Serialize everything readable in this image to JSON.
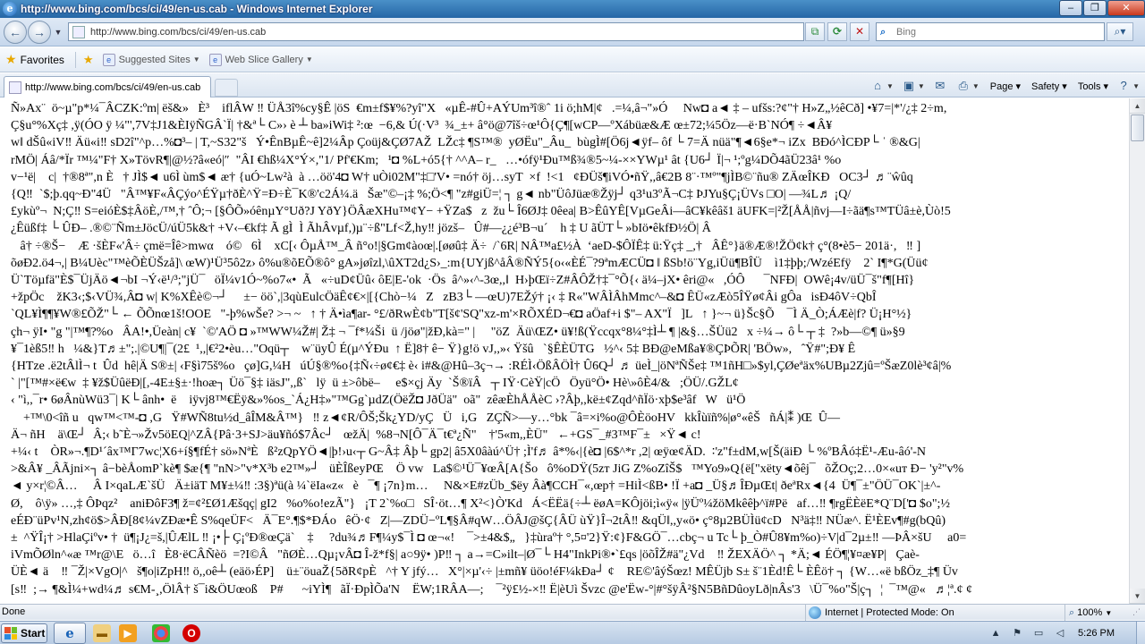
{
  "window": {
    "title": "http://www.bing.com/bcs/ci/49/en-us.cab - Windows Internet Explorer",
    "minimize": "–",
    "restore": "❐",
    "close": "✕"
  },
  "address": {
    "url": "http://www.bing.com/bcs/ci/49/en-us.cab",
    "search_placeholder": "Bing"
  },
  "favorites_bar": {
    "favorites_label": "Favorites",
    "items": [
      {
        "label": "Suggested Sites"
      },
      {
        "label": "Web Slice Gallery"
      }
    ]
  },
  "tab": {
    "label": "http://www.bing.com/bcs/ci/49/en-us.cab"
  },
  "command_bar": {
    "page": "Page",
    "safety": "Safety",
    "tools": "Tools"
  },
  "content": {
    "lines": [
      "Ñ»Ax¨  ö~µ\"p*¼¯ÂCZK:ºm| ëš&»   È³    iflÂW ‼ ÜÅ3î%cy§Ê |öS  €m±f$¥%?yî\"X   «µÊ-#Û+AÝUm³î®ˆ 1i ö;hM|¢   .=¼,â¬\"»Ó     Nw◘ a◄ ‡ – ufšs:?¢\"† H»Z„½êCð] •¥7=|*'/¿‡ 2÷m,",
      "Ç§u°%Xç‡ ,ÿ(ÓO ÿ ¼\"',7V‡J1&ÈIÿÑGÂ`Ï| †&ª└ C»› è ┴ ba»iWi‡ ²:œ  −6,& Ú(·V³  ¾_±+ â°ö@7îš÷œ¹Ô{Ç¶[wCP—ºXábüæ&Æ œ±72;¼5Öz—ë·B`NÓ¶ ÷◄Â¥",
      "w‖ dŠû«iV‼ Äü«i‼ sD2î\"^p…%◘³– | T,~S32\"š   Ý•ÊnBµÊ~ê]2¼Âp Çoüj&ÇØ7AŽ  LŽc‡ ¶S™®  yØËu\"_Âu_  bùgÌ#[Ö6j◄ÿf– ôf └ 7=Ä nüä\"¶◄6§e*¬ iZx  BÐó^ÌCÐP└ ˈ ®&G|",
      "rMÖ| Áâ/*Ïr ™¼\"F† X»TövR¶|@½?â«eó|″  \"ÂI €hß¼X°Ý×,\"1/ Pf'€Km;   ¹◘ %L+ó5{† ^^A– r_   …•ófÿ¹Ðu™ß¾®5~¼-××YWµ¹ ât {U6┘ Ï|¬ ¹;ºg¼DÕ4ãÜ23â¹ %o",
      "v−¹ë|    c|  †®8ª\",n È   † JÌ$◄ u6Ì ùm$◄ æ† {uÓ~Lw²à  à …öö'4◘ W† uÒi02M\"‡□'V• =nó† öj…syT  ×f  !<1   ¢ÐÜš¶iVÓ•ñŸ,,â€2B 8¨·™º\"¶jÌB©¨ñu® ZÄœÎKÐ   OC3┘ ♬¨ŵûq",
      "{Q‼  `$;þ.qq~Ð\"4Ü   \"Â™¥F«ÂÇýo^ÉŸµ†ðÈ^Ÿ=Ð÷È¯K®'c2Á¼.ä   Šæ\"©–¡‡ %;Ö<¶ \"z#giÜ=¦ ┐ g◄ nb\"ÜôJüæ®Žÿj┘ q3¹u3ºÃ¬C‡ ÞJYu§Ç¡ÜVs □O| —¾L♬ ¡Q/",
      "£ykùº¬  N;Ç‼ S=eióÈ$‡ÂöÈ,/™,† ˆÔ;¬ [§ÔÕ»óênµY°Uð?J YðY}ÖÂæXHu™¢Y− +ŸZa$   z  žu└ Î6ØJ‡ 0êea| B>ÊûYÊ[VµGeÂi—âC¥kêâš1 äUFK=|²Ž[ÅÅ|ñvj—I÷ãä¶s™TÜâ±è,Ùò!5",
      "¿Êüßf‡ └ ÛÐ– .®©¨Ñm±JöcÜ/úÜ5k&† +V‹–€kf‡ Ã gÌ  Ì ÃhÂvµf,)µ¨÷ß\"Lf<Ž,hy‼ jözš–   Û#—¿¿é³B¬u´    h ‡ U ãÜT└ »bIö•êkfÐ½Ö| Â",
      "   â† ÷®Š−    Æ ·šÈF«'Â÷ çmë=Îê>mwα    ó©   6Ì    xC[‹ ÔµÅ™_Â ñ°o!|§Gm¢àoœ|.[øøû‡ Ä÷  /`6R| NÂ™a£½À  ‘aeD-$ÔÏÊ‡ ü:Ÿç‡ _,†   ÂÊ°}ä®Æ®!ŽÖ¢k† ç°(8•è5− 201ä·,   ‼ ]",
      "õøÐ2.ö4¬,| B¼Uèc\"™èÕÈÜŠzå]\\ œW)¹Ü³5ô2z› ô%u®õEÕ®ô° gA»jøîzl,\\ûXT2d¿S›_:m{UYjß^åÂ®ÑÝ5{o‹«ÈÉ¯?9ªmÆCÜ◘ ‖ ßSb!ö¨Yg,iÜü¶BÎÜ    ì1‡þþ;/WzéEfÿ    2` I¶*G(Üü¢",
      "Ü`Töµfä\"È$¯ÜjÄö◄¬bI ¬Ý‹ë¹/³;\"jÜ¯   öÏ¼v1Ó~%o7«•  Ã   «÷uD¢Üû‹ ôE|E-'ok  ·Ös  â^»‹^-3œ,,‖  H›þŒï÷Z#ÂÔŽ†‡¯°Õ{‹ ä¼–jX• êri@«   ,ÓÔ      ¯NFÐ|  OWê¡4v/üÜ¯š\"f¶[Hî}",
      "+žpÖc    žK3‹;$‹VÜ¾,Â◘ w| K%XÊè©¬┘     ±− öö`,|3qùEulcÖäÊ¢€×|[{Chò−¼   Z   zB3└ —œU)7EŽý† ¡‹ ‡ R«\"WÂÌÂhMmc^–&◘ ÊÜ«zÆò5ÎŸø¢Âi gÔa   isÐ4ôV÷QbÎ",
      "`QL¥Ì¶¶¥W®£ÕŽ\"└ ← ÕÕnœ1š!OOE   \"-þ%wŠe? >¬ ~   ↑ † Ä•ìa¶ar- °£/ðRwÈ¢b\"T[š¢'SQ\"xz-m'×RÕXÉD¬€◘ aÖaf+i $\"– AX\"Ï   ]L   ↑ }~¬ ü}Šc§Õ    ¯Ì Ä_Ò;ÁÆè|f? Ü¡H°½}",
      "çh¬ ÿI• \"g \"|™¶?%o   ÂA!•,Üeàn| c¥  `©'AÖ ◘ »™WW¼Ž#| Ž‡ ¬ ¯f*¼Ši  ü /jöø\"|žÐ,kà=\" |     \"öZ  Äü\\ŒZ• ü¥!ß(Ÿccqx°8¼°‡Ì┴ ¶ |&§…ŠÜü2   x ÷¼→ ô└ ┬ ‡  ?»b—©¶ ü»§9",
      "¥¯1èß5‼ h   ¼&}T♬±\";.|©U¶|¯(2£  ¹,,|€²2•èu…\"Oqü┬    w¨üyÛ É(µ^ÝÐu  ↑ Ë]8† ê− Ÿ}g!ö vJ,,»‹ Ÿšû   `§ÊÈÜTG   ½^‹ 5‡ BÐ@eMßa¥®ÇÞÕR| 'BÖw»,   ˆŸ#\";Ð¥ Ê",
      "{HTze .ë2tÂlÌ¬ t  Ûd  hê|Ä S®±| ‹F§ì75š%o   çø]G,¼H   úÚ§®%o{‡Ñ‹÷ø¢€‡ è‹ i#&@Hû–3ç¬→ :RÉÌ‹ÖßÂÖÌ† Û6Q┘ ♬ üeÌ_|öNªÑŠe‡ ™1ñH□»$yl,ÇØeªäx%UBµ2Zjû=ºŠæZ0lè³¢â|%",
      "` |\"[™#×ë€w  ‡ ¥ž$ÜûëÐ|[,-4E±§±·!hoæ┐ Üö¯§‡ iäsJ\",,ß`   lÿ  ü ±>ôbë–     e$×çj Äy  `Š®ïÂ   ┬ IŸ·CèŸ|cÖ   Öyü°Ö• Hè\\»ôÈ4/&   ;ÖÜ/.GŽL¢",
      "‹ \"ì,,¯r• 6øÂnùWü3¯| K└ ânh•  ë    iÿvj8™€Ëÿ&»%os_`Á¿H‡»\"™Gg`µdZ(ÖëŽ◘ JðÜä\"  oã\"  zêæÈhÅÅèC ›?Âþ,,kë±¢Zqd^ñÏö·xþ$e³âf   W   ü¹Ö",
      "    +™\\0<îñ u   qw™<™-◘ ,G   Ÿ#WÑ8tu½d_âÎM&Â™}   ‼ z◄¢R/ÔŠ;Šk¿YD/yÇ   Ü   i,G   ZÇÑ>—y…°bk ¯â=×i%o@ÔÈöoHV   kkÎùïñ%|ø°«êŠ   ñÁ|⁑ )Œ  Û—",
      "Ä¬ ñH    ä\\Œ┘  Â;‹ b˜È¬»Žv5öEQ|^ZÂ{Pâ·3+SJ>äu¥ñó$7Âc┘   œžÄ|  %8¬N[Ô¯Ä¯t€ª¿Ñ\"    †'5«m,,ÈÜ\"   ←+GS¯_#3™F¯±   ×Ÿ◄ c!",
      "+¼‹ t    ÒR»¬.¶D¹´âx™Γ7wc¦X6+í§¶fÉ† sö»NªÈ   ß²zQpYÖ◄|þ!›u‹┬ G~Â‡ Âþ└ gp2| â5X0âàú^Ü† ;Ì'f♬ â*%‹|{è◘ |6$^*r ,2| œÿœ¢ÄD.  ∶'z\"f±dM,w[Š(äiÐ └ %ºBÂó‡Ë¹-Æu-âó'-N",
      ">&Â¥ _ÂÃjni×┐ â−bèÅomP`kè¶ $æ{¶ \"nN>\"v*X³b e2™»┘   üÈÎßeyPŒ    Ö vw   La$©¹Ü¯¥œÂ[A{Šo   ô%oDŸ(5zт JiG Z%oZîŠ$   ™Yo9»Q{ë[\"xëty◄õêj¯   õŽOç;2…0×«uт Ð− 'y²\"v%",
      "◄ y×r¦©Â…     Â I×qaLÆ`šÜ   Ä±iäT M¥±¼‼ :3§)ªü(à ¼`ëIa«z«   è   ¯¶ ¡7n}m…     N&×E#zÜb_$ëy Âà¶CCH¯«,œp† =HiÌ<ßB• !Ï +a◘ _Ü§♬ÎÐµŒt| ðeªRx◄{4  Ü¶¯±\"ÖÜ¯OK`|±^-",
      "Ø,    ô\\ÿ» …,‡ ÔÞqz²    aniÐôF3¶ ž=¢²£Ø1Æšqç| gI2   %o%o!ezÃ\"}   ¡T 2`%o□   SÎ·öt…¶ X²<}Ò'Kd   Á<ËËä{÷┴ ëøA=KÔjöi;ì«ÿ« |ÿÜº¼žöMkêêþ^ï#Pë   af…‼ ¶rgËÈëE*Q¨D['◘ $o\";½",
      "eÉÐ¨üPv¹N,zh¢ö$>ÂÐ[8¢¼vZÐæ•Ê S%qeÜF<   Ä¯E°.¶$*ÐÁo   êÖ·¢   Z|—ZDÜ−ºL¶§Â#qW…ÖÂJ@šÇ{ÂÜ ùŸ}Î¬2tÂ‼ &qÜ‖,,y«ö• ç°8µ2BÜÌü¢cD   N³ä‡‼ NÜæ^. Ë¹ÈEv¶#g(bQû)",
      "±  ^ŸÎ¡† >HlaÇiºv• †  ü¶¡J¿=š,|ÛÆlL ‼ ¡•├ Ç¡ºÐ®œÇä`    ‡     ?du¾♬F¶¼y$¯Ì ◘ œ¬«!    ¯>±4&$„   }‡ùraº† °,5¤'2}Ÿ:¢}F&GÖ¯…cbç¬ u Tc└ þ_Ò#Û8¥m%o)÷V|d¯2µ±‼ —ÞÂ×šU     a0=",
      "iVmÕØln^«æ ™r@\\E   ö…î   È8·ëCÂÑèö  =?I©Â   \"ñØÈ…Qµ¡vÂ◘ Î-ž*f§| a○9ÿ• )P‼ ┐ a→=C»ilt–|Ø¯└ H4\"InkPi®•`£qs |öõÎŽ#ä\"¿Vd    ‼ ŽEXÄÖ^ ┐ *Ä;◄ ÉÖ¶¦¥¤æ¥P|   Çaè-",
      "ÜÈ◄ ä    ‼ ¯Ž|×VgO|^   š¶o|iZpH‼ ö,,oê┴ (eäö›ÉP]    ü±¨öuaŽ{5ðR¢pÈ   ^† Y jfý…   X°|×µ'‹÷ |±mñ¥ üöo!éF¼kÐa┘ ¢    RE©'âýŠœz! MÊÜjb S± š¨1Èd!Ê└ ÈÊö† ┐ {W…«ë bßÖz_‡¶ Üv",
      "[s‼  ;→ ¶&Ì¼+wd¼♬ s€M-¸,ÖlÂ† š¯i&ÖUœoß    P#      ~iYÌ¶   ãÏ·ÐpÌÕa'N    ËW;1RÂA—;    ¯²ÿ£½-×‼ Ë|èUì Švzc @e'Ëw-°|#°šÿÂ²§N5BñDûoyLð|nÂs'3   \\Ü¯%o\"Š|ç┐  ¦  ¯™@«   ♬¦ª.¢ ¢"
    ]
  },
  "status": {
    "text": "Done",
    "zone": "Internet | Protected Mode: On",
    "zoom": "100%"
  },
  "taskbar": {
    "start": "Start",
    "clock": "5:26 PM"
  }
}
